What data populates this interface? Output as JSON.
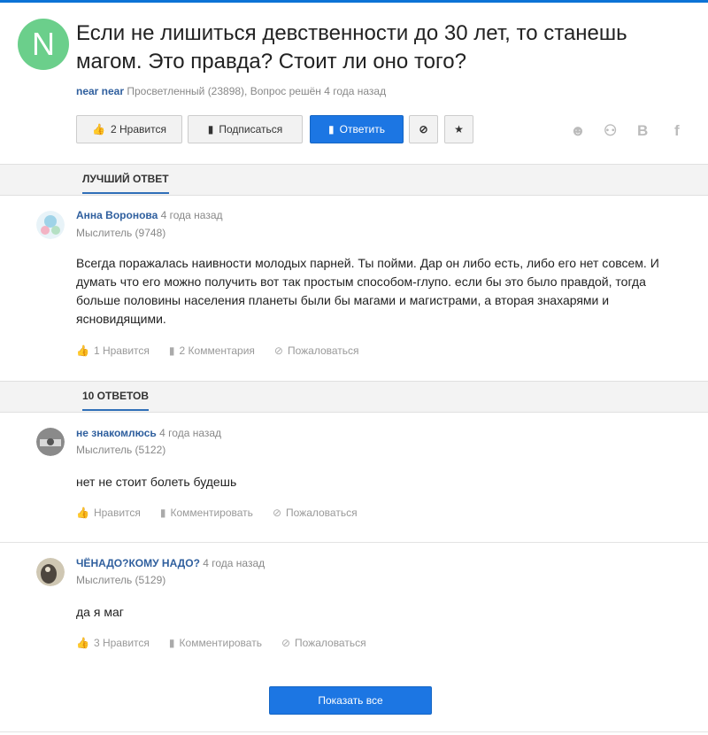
{
  "question": {
    "avatar_letter": "N",
    "title": "Если не лишиться девственности до 30 лет, то станешь магом. Это правда? Стоит ли оно того?",
    "author": "near near",
    "author_rank": "Просветленный (23898),",
    "status": "Вопрос решён 4 года назад"
  },
  "toolbar": {
    "like_label": "2 Нравится",
    "subscribe_label": "Подписаться",
    "answer_label": "Ответить"
  },
  "share": [
    "ᵛ",
    "ok",
    "B",
    "f"
  ],
  "best_answer": {
    "tab_label": "ЛУЧШИЙ ОТВЕТ",
    "author": "Анна Воронова",
    "time": "4 года назад",
    "rank": "Мыслитель (9748)",
    "text": "Всегда поражалась наивности молодых парней. Ты пойми. Дар он либо есть, либо его нет совсем. И думать что его можно получить вот так простым способом-глупо. если бы это было правдой, тогда больше половины населения планеты были бы магами и магистрами, а вторая знахарями и ясновидящими.",
    "likes": "1 Нравится",
    "comments": "2 Комментария",
    "report": "Пожаловаться"
  },
  "answers_tab": "10 ОТВЕТОВ",
  "answers": [
    {
      "author": "не знакомлюсь",
      "time": "4 года назад",
      "rank": "Мыслитель (5122)",
      "text": "нет не стоит болеть будешь",
      "likes": "Нравится",
      "comment": "Комментировать",
      "report": "Пожаловаться"
    },
    {
      "author": "ЧЁНАДО?КОМУ НАДО?",
      "time": "4 года назад",
      "rank": "Мыслитель (5129)",
      "text": "да я маг",
      "likes": "3 Нравится",
      "comment": "Комментировать",
      "report": "Пожаловаться"
    }
  ],
  "show_all_label": "Показать все",
  "colors": {
    "accent": "#1c76e3",
    "avatar": "#6bcf8b",
    "link": "#2f5f9e"
  }
}
